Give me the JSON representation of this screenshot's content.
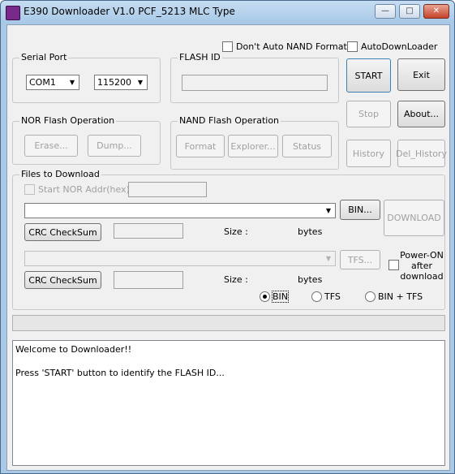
{
  "window": {
    "title": "E390 Downloader V1.0 PCF_5213  MLC Type",
    "minimize_icon": "minimize-icon",
    "maximize_icon": "maximize-icon",
    "close_icon": "close-icon"
  },
  "options": {
    "dont_auto_nand": "Don't Auto NAND Format",
    "auto_downloader": "AutoDownLoader"
  },
  "serial_port": {
    "label": "Serial Port",
    "port": "COM1",
    "baud": "115200"
  },
  "flash_id": {
    "label": "FLASH ID",
    "value": ""
  },
  "buttons": {
    "start": "START",
    "exit": "Exit",
    "stop": "Stop",
    "about": "About...",
    "history": "History",
    "del_history": "Del_History"
  },
  "nor": {
    "label": "NOR Flash Operation",
    "erase": "Erase...",
    "dump": "Dump..."
  },
  "nand": {
    "label": "NAND Flash Operation",
    "format": "Format",
    "explorer": "Explorer...",
    "status": "Status"
  },
  "files": {
    "label": "Files to Download",
    "start_nor_addr": "Start NOR Addr(hex):",
    "bin_button": "BIN...",
    "download_button": "DOWNLOAD",
    "crc_button": "CRC CheckSum",
    "size_label": "Size :",
    "bytes_label": "bytes",
    "tfs_button": "TFS...",
    "power_on": [
      "Power-ON",
      "after",
      "download"
    ],
    "radio_bin": "BIN",
    "radio_tfs": "TFS",
    "radio_bin_tfs": "BIN + TFS",
    "selected_mode": "BIN"
  },
  "log": [
    "Welcome to Downloader!!",
    "Press 'START' button to identify the FLASH ID..."
  ]
}
